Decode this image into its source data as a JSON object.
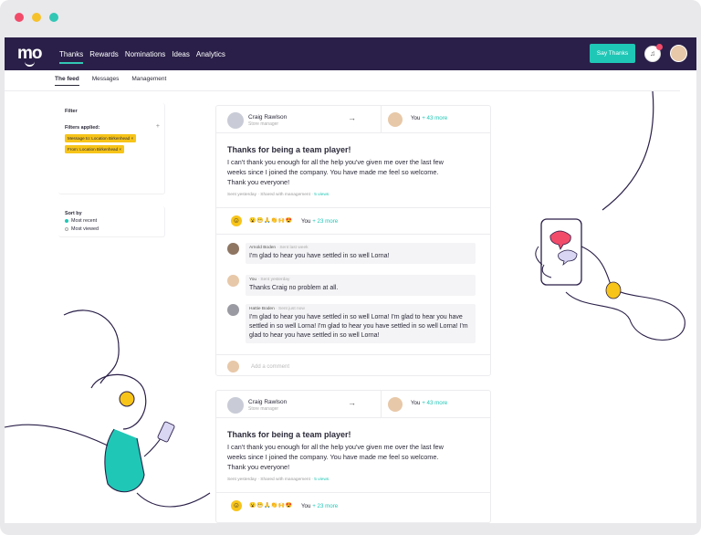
{
  "nav": {
    "logo": "mo",
    "items": [
      "Thanks",
      "Rewards",
      "Nominations",
      "Ideas",
      "Analytics"
    ],
    "active": "Thanks",
    "say_thanks": "Say Thanks"
  },
  "subnav": {
    "items": [
      "The feed",
      "Messages",
      "Management"
    ]
  },
  "filter": {
    "title": "Filter",
    "applied_label": "Filters applied:",
    "tags": [
      "Message to: Location Birkenhead ×",
      "From: Location Birkenhead ×"
    ],
    "sort_label": "Sort by",
    "sort_options": [
      "Most recent",
      "Most viewed"
    ]
  },
  "posts": [
    {
      "author": "Craig Rawlson",
      "role": "Store manager",
      "recipient": "You",
      "recipient_more": "+ 43 more",
      "title": "Thanks for being a team player!",
      "body": "I can't thank you enough for all the help you've given me over the last few weeks since I joined the company. You have made me feel so welcome. Thank you everyone!",
      "meta": "Sent yesterday · Shared with management · ",
      "views": "5 views",
      "react_you": "You",
      "react_more": "+ 23 more",
      "comments": [
        {
          "name": "Arnold Boden",
          "when": " · Sent last week",
          "text": "I'm glad to hear you have settled in so well Lorna!"
        },
        {
          "name": "You",
          "when": " · Sent yesterday",
          "text": "Thanks Craig no problem at all."
        },
        {
          "name": "Hattie Boden",
          "when": " · Sent just now",
          "text": "I'm glad to hear you have settled in so well Lorna! I'm glad to hear you have settled in so well Lorna! I'm glad to hear you have settled in so well Lorna! I'm glad to hear you have settled in so well Lorna!"
        }
      ],
      "add_comment": "Add a comment"
    },
    {
      "author": "Craig Rawlson",
      "role": "Store manager",
      "recipient": "You",
      "recipient_more": "+ 43 more",
      "title": "Thanks for being a team player!",
      "body": "I can't thank you enough for all the help you've given me over the last few weeks since I joined the company. You have made me feel so welcome. Thank you everyone!",
      "meta": "Sent yesterday · Shared with management · ",
      "views": "5 views",
      "react_you": "You",
      "react_more": "+ 23 more"
    }
  ],
  "colors": {
    "nav_bg": "#2a1f48",
    "accent": "#1fc7b6",
    "tag": "#f7c419"
  }
}
